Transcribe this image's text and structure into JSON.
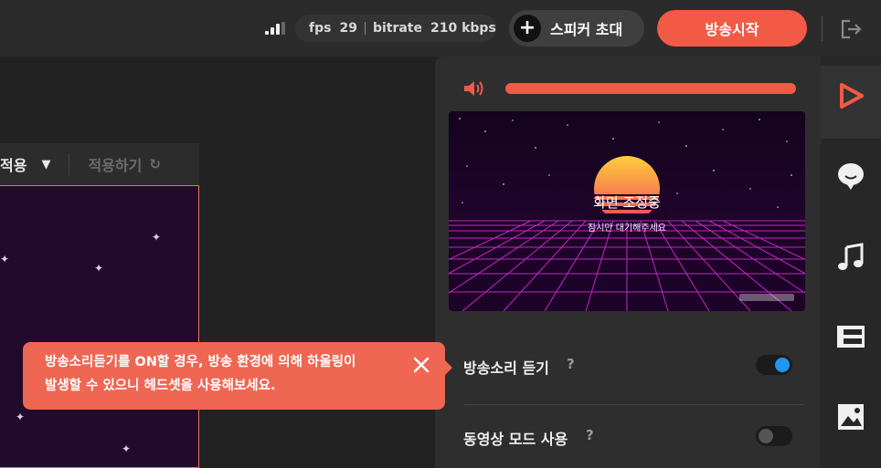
{
  "header": {
    "fps_label": "fps",
    "fps_value": "29",
    "bitrate_label": "bitrate",
    "bitrate_value": "210 kbps",
    "invite_label": "스피커 초대",
    "start_label": "방송시작"
  },
  "toolbar": {
    "apply_option": "적용",
    "apply_action": "적용하기"
  },
  "panel": {
    "volume_level": 1.0,
    "preview_title": "화면 조정중",
    "preview_subtitle": "잠시만 대기해주세요",
    "monitor_label": "방송소리 듣기",
    "monitor_on": true,
    "video_mode_label": "동영상 모드 사용",
    "video_mode_on": false,
    "help_mark": "?"
  },
  "tooltip": {
    "line1": "방송소리듣기를 ON할 경우, 방송 환경에 의해 하울링이",
    "line2": "발생할 수 있으니 헤드셋을 사용해보세요."
  },
  "sidebar": {
    "items": [
      {
        "icon": "play-icon",
        "active": true
      },
      {
        "icon": "chat-bubble-icon",
        "active": false
      },
      {
        "icon": "music-note-icon",
        "active": false
      },
      {
        "icon": "layout-icon",
        "active": false
      },
      {
        "icon": "image-icon",
        "active": false
      }
    ]
  },
  "colors": {
    "accent": "#f25a45",
    "toggle_on": "#2196f3",
    "toggle_off": "#555555",
    "background": "#212121"
  }
}
